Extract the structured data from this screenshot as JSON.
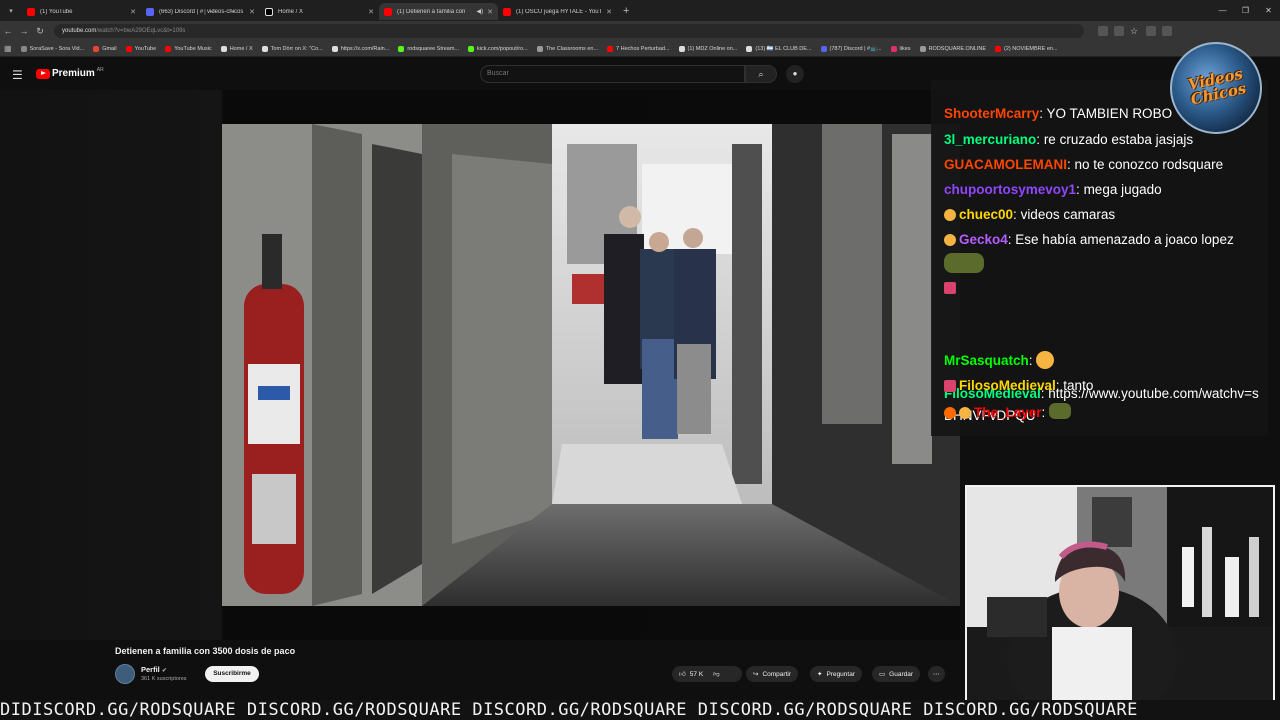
{
  "browser": {
    "tabs": [
      {
        "label": "(1) YouTube",
        "favicon_color": "#ff0000",
        "active": false
      },
      {
        "label": "(663) Discord | #│vi̶deos-ch̶icos",
        "favicon_color": "#5865f2",
        "active": false
      },
      {
        "label": "Home / X",
        "favicon_color": "#ffffff",
        "active": false
      },
      {
        "label": "(1) Detienen a familia con",
        "favicon_color": "#ff0000",
        "active": true
      },
      {
        "label": "(1) OSCU juega HYTALE - YouTube",
        "favicon_color": "#ff0000",
        "active": false
      }
    ],
    "url_host": "youtube.com",
    "url_path": "/watch?v=bwA29OEqLvc&t=109s",
    "bookmarks": [
      {
        "label": "SoraSave - Sora Vid...",
        "color": "#888888"
      },
      {
        "label": "Gmail",
        "color": "#ea4335"
      },
      {
        "label": "YouTube",
        "color": "#ff0000"
      },
      {
        "label": "YouTube Music",
        "color": "#ff0000"
      },
      {
        "label": "Home / X",
        "color": "#dddddd"
      },
      {
        "label": "Tom Dörr on X: \"Co...",
        "color": "#dddddd"
      },
      {
        "label": "https://x.com/Rain...",
        "color": "#dddddd"
      },
      {
        "label": "rodsquaree Stream...",
        "color": "#53fc18"
      },
      {
        "label": "kick.com/popout/ro...",
        "color": "#53fc18"
      },
      {
        "label": "The Classrooms en...",
        "color": "#9a9a9a"
      },
      {
        "label": "7 Hechos Perturbad...",
        "color": "#ff0000"
      },
      {
        "label": "(1) MDZ Online on...",
        "color": "#dddddd"
      },
      {
        "label": "(13) 🇦🇷 EL CLUB DE...",
        "color": "#dddddd"
      },
      {
        "label": "(787) Discord | #📺...",
        "color": "#5865f2"
      },
      {
        "label": "likes",
        "color": "#e1306c"
      },
      {
        "label": "RODSQUARE.ONLINE",
        "color": "#9a9a9a"
      },
      {
        "label": "(2) NOVIEMBRE en...",
        "color": "#ff0000"
      }
    ]
  },
  "youtube": {
    "logo_text": "Premium",
    "country": "AR",
    "search_placeholder": "Buscar",
    "video_title": "Detienen a familia con 3500 dosis de paco",
    "channel_name": "Perfil",
    "subscribers": "361 K suscriptores",
    "subscribe_label": "Suscribirme",
    "likes": "57 K",
    "share_label": "Compartir",
    "ask_label": "Preguntar",
    "save_label": "Guardar"
  },
  "chat": {
    "messages": [
      {
        "user": "ShooterMcarry",
        "color": "#ff4500",
        "text": "YO TAMBIEN ROBO"
      },
      {
        "user": "3l_mercuriano",
        "color": "#00ff7f",
        "text": "re cruzado estaba jasjajs"
      },
      {
        "user": "GUACAMOLEMANI",
        "color": "#ff4500",
        "text": "no te conozco rodsquare"
      },
      {
        "user": "chupoortosymevoy1",
        "color": "#9146ff",
        "text": "mega jugado"
      },
      {
        "user": "chuec00",
        "color": "#ffd700",
        "text": "videos camaras"
      },
      {
        "user": "Gecko4",
        "color": "#b55cff",
        "text": "Ese había amenazado a joaco lopez"
      },
      {
        "user": "FilosoMedieval",
        "color": "#00ff7f",
        "text": "https://www.youtube.com/watchv=sBHNVFvDPQU"
      },
      {
        "user": "MrSasquatch",
        "color": "#00ff00",
        "text": ""
      },
      {
        "user": "FilosoMedieval",
        "color": "#ffd700",
        "text": "tanto"
      },
      {
        "user": "The_Layer",
        "color": "#ff0000",
        "text": ""
      }
    ]
  },
  "overlay": {
    "logo_text_1": "Videos",
    "logo_text_2": "Chicos",
    "ticker": "DIDISCORD.GG/RODSQUARE DISCORD.GG/RODSQUARE DISCORD.GG/RODSQUARE DISCORD.GG/RODSQUARE DISCORD.GG/RODSQUARE"
  }
}
